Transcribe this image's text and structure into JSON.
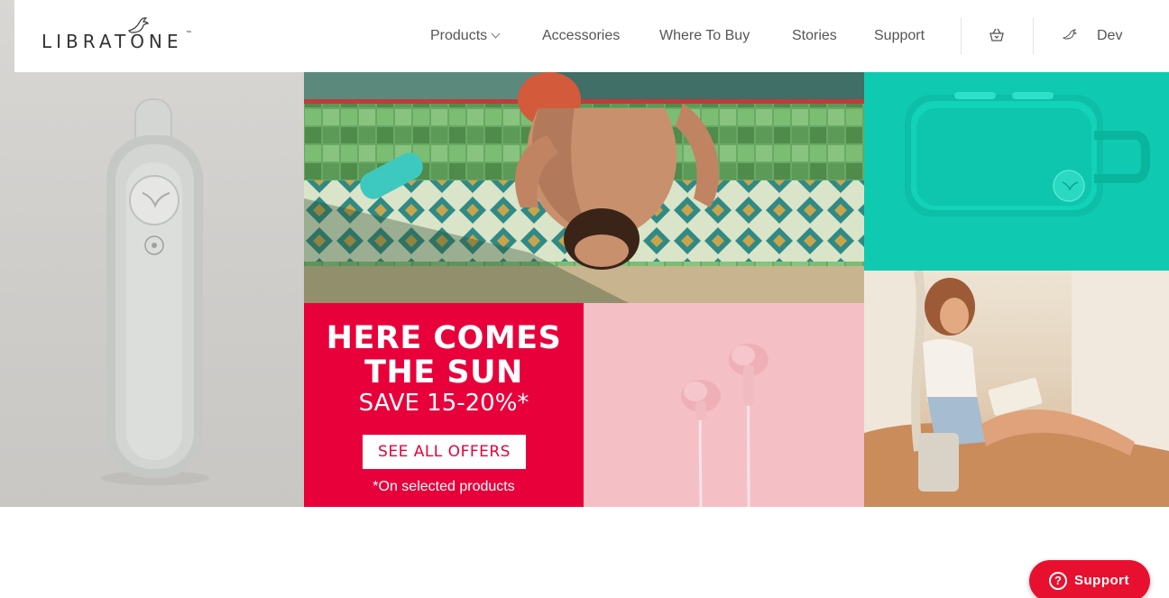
{
  "header": {
    "logo_text": "LIBRATONE",
    "logo_tm": "™",
    "nav": [
      {
        "label": "Products"
      },
      {
        "label": "Accessories"
      },
      {
        "label": "Where To Buy"
      },
      {
        "label": "Stories"
      },
      {
        "label": "Support"
      }
    ],
    "cart_icon": "shopping-basket-icon",
    "dev_icon": "bird-icon",
    "dev_label": "Dev"
  },
  "promo": {
    "headline_line1": "HERE COMES",
    "headline_line2": "THE SUN",
    "save_text": "SAVE 15-20%*",
    "button_label": "SEE ALL OFFERS",
    "footnote": "*On selected products"
  },
  "support_button": {
    "icon": "question-circle-icon",
    "label": "Support"
  },
  "colors": {
    "brand_red": "#e8003a",
    "teal": "#0fcab0",
    "pink": "#f4c0c5"
  }
}
